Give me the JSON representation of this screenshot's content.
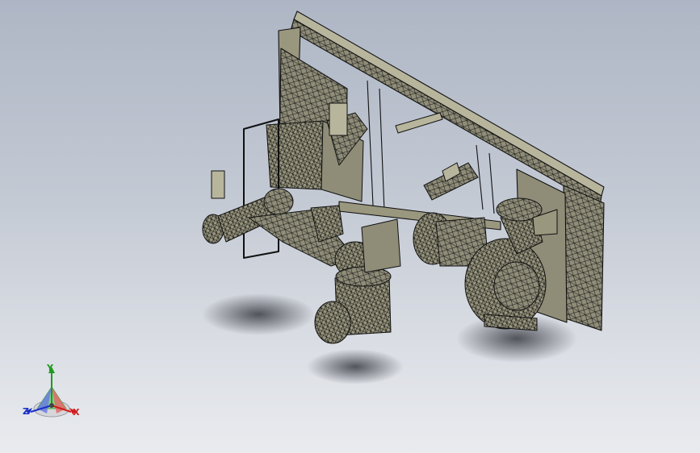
{
  "viewport": {
    "background_top": "#aeb6c5",
    "background_bottom": "#e9ebee",
    "model_fill": "#8f8d78",
    "model_fill_light": "#b8b59d",
    "model_fill_dark": "#5e5c4c",
    "edge_color": "#111111"
  },
  "triad": {
    "x_label": "X",
    "y_label": "Y",
    "z_label": "Z",
    "x_color": "#d11a1a",
    "y_color": "#1f9a1f",
    "z_color": "#1a2fc8"
  }
}
